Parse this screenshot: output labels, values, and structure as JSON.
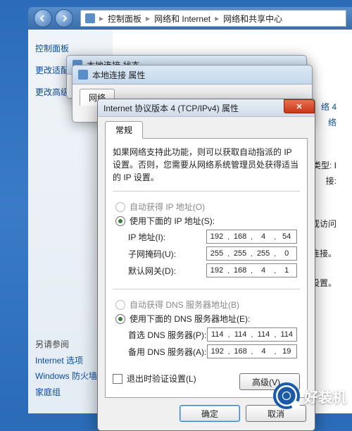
{
  "breadcrumb": {
    "root": "控制面板",
    "mid": "网络和 Internet",
    "leaf": "网络和共享中心"
  },
  "sidebar": {
    "link1": "控制面板",
    "link2": "更改适配",
    "link3": "更改高级",
    "footer_heading": "另请参阅",
    "footer1": "Internet 选项",
    "footer2": "Windows 防火墙",
    "footer3": "家庭组"
  },
  "behind1_title": "本地连接 状态",
  "behind2_title": "本地连接 属性",
  "behind2_tab": "网络",
  "main_right": {
    "r1": "络 4",
    "r2": "络",
    "r3": "问类型:      I",
    "r4": "接:",
    "r5": "置路由器或访问",
    "r6": "速连接。",
    "r7": "改共享设置。"
  },
  "dialog": {
    "title": "Internet 协议版本 4 (TCP/IPv4) 属性",
    "tab": "常规",
    "desc": "如果网络支持此功能，则可以获取自动指派的 IP 设置。否则，您需要从网络系统管理员处获得适当的 IP 设置。",
    "auto_ip": "自动获得 IP 地址(O)",
    "manual_ip": "使用下面的 IP 地址(S):",
    "ip_label": "IP 地址(I):",
    "mask_label": "子网掩码(U):",
    "gw_label": "默认网关(D):",
    "ip": {
      "a": "192",
      "b": "168",
      "c": "4",
      "d": "54"
    },
    "mask": {
      "a": "255",
      "b": "255",
      "c": "255",
      "d": "0"
    },
    "gw": {
      "a": "192",
      "b": "168",
      "c": "4",
      "d": "1"
    },
    "auto_dns": "自动获得 DNS 服务器地址(B)",
    "manual_dns": "使用下面的 DNS 服务器地址(E):",
    "dns1_label": "首选 DNS 服务器(P):",
    "dns2_label": "备用 DNS 服务器(A):",
    "dns1": {
      "a": "114",
      "b": "114",
      "c": "114",
      "d": "114"
    },
    "dns2": {
      "a": "192",
      "b": "168",
      "c": "4",
      "d": "19"
    },
    "validate": "退出时验证设置(L)",
    "advanced": "高级(V)...",
    "ok": "确定",
    "cancel": "取消"
  },
  "watermark": "好装机"
}
